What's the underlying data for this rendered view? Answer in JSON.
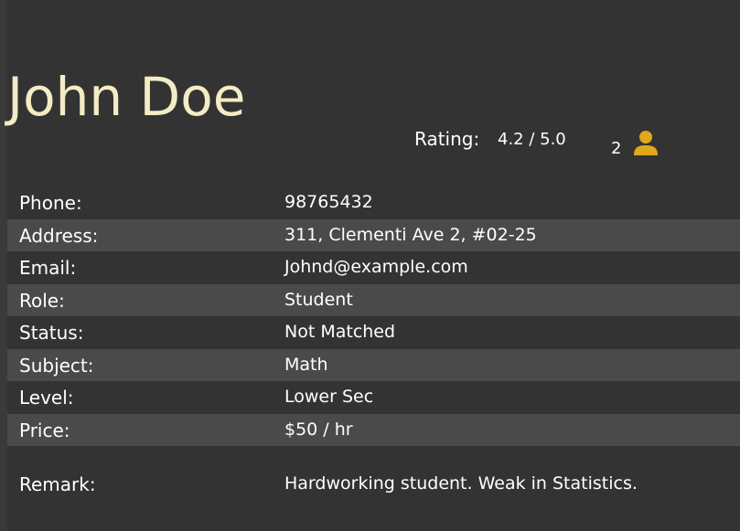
{
  "profile": {
    "name": "John Doe",
    "rating_label": "Rating:",
    "rating_value": "4.2  / 5.0",
    "count": "2",
    "count_icon": "person-icon"
  },
  "details": [
    {
      "key": "Phone:",
      "value": "98765432"
    },
    {
      "key": "Address:",
      "value": "311, Clementi Ave 2, #02-25"
    },
    {
      "key": "Email:",
      "value": "Johnd@example.com"
    },
    {
      "key": "Role:",
      "value": "Student"
    },
    {
      "key": "Status:",
      "value": "Not Matched"
    },
    {
      "key": "Subject:",
      "value": "Math"
    },
    {
      "key": "Level:",
      "value": "Lower Sec"
    },
    {
      "key": "Price:",
      "value": "$50 / hr"
    }
  ],
  "remark": {
    "key": "Remark:",
    "value": "Hardworking student. Weak in Statistics."
  },
  "colors": {
    "background": "#333333",
    "alt_row": "#4a4a4a",
    "name": "#f3ecc4",
    "icon": "#e0a81c"
  }
}
